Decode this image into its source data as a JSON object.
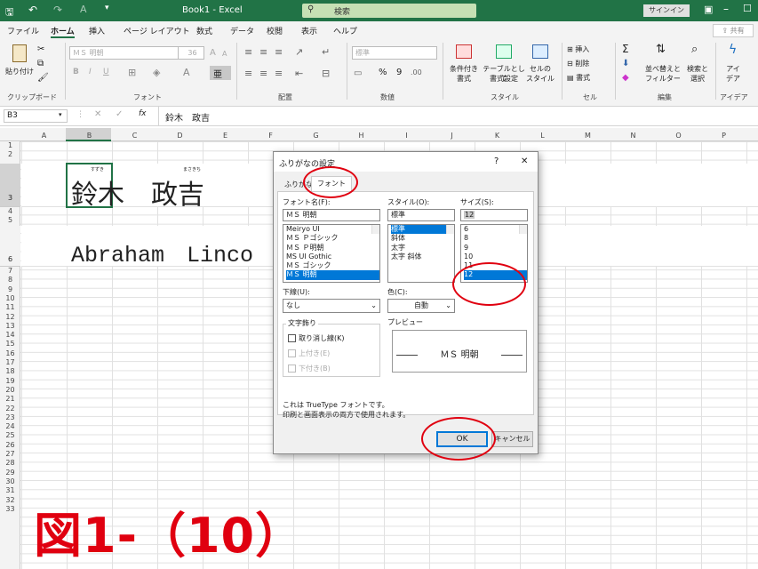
{
  "title_bar": {
    "title": "Book1 - Excel",
    "search_placeholder": "検索",
    "signin": "サインイン"
  },
  "menu": {
    "tabs": [
      "ファイル",
      "ホーム",
      "挿入",
      "ページ レイアウト",
      "数式",
      "データ",
      "校閲",
      "表示",
      "ヘルプ"
    ],
    "share": "共有"
  },
  "ribbon": {
    "paste": "貼り付け",
    "clipboard": "クリップボード",
    "font_name": "ＭＳ 明朝",
    "font_size": "36",
    "font_group": "フォント",
    "alignment_group": "配置",
    "number_format": "標準",
    "number_group": "数値",
    "conditional": [
      "条件付き",
      "書式"
    ],
    "table": [
      "テーブルとして",
      "書式設定"
    ],
    "cellstyle": [
      "セルの",
      "スタイル"
    ],
    "style_group": "スタイル",
    "insert": "挿入",
    "delete": "削除",
    "format": "書式",
    "cell_group": "セル",
    "sort": [
      "並べ替えと",
      "フィルター"
    ],
    "find": [
      "検索と",
      "選択"
    ],
    "edit_group": "編集",
    "ideas": [
      "アイ",
      "デア"
    ],
    "ideas_group": "アイデア",
    "bold": "B",
    "italic": "I",
    "underline": "U",
    "percent": "%",
    "comma": "9"
  },
  "formula_bar": {
    "name_box": "B3",
    "fx": "fx",
    "formula": "鈴木　政吉"
  },
  "columns": [
    "A",
    "B",
    "C",
    "D",
    "E",
    "F",
    "G",
    "H",
    "I",
    "J",
    "K",
    "L",
    "M",
    "N",
    "O",
    "P"
  ],
  "rows": [
    "1",
    "2",
    "3",
    "4",
    "5",
    "6",
    "7",
    "8",
    "9",
    "10",
    "11",
    "12",
    "13",
    "14",
    "15",
    "16",
    "17",
    "18",
    "19",
    "20",
    "21",
    "22",
    "23",
    "24",
    "25",
    "26",
    "27",
    "28",
    "29",
    "30",
    "31",
    "32",
    "33"
  ],
  "cells": {
    "b3_text": "鈴木　政吉",
    "furigana1": "すずき",
    "furigana2": "まさきち",
    "b6_text": "Abraham　Linco"
  },
  "figure_label": "図1-（10）",
  "dialog": {
    "title": "ふりがなの設定",
    "help": "?",
    "close": "✕",
    "tab1": "ふりがな",
    "tab2": "フォント",
    "font_label": "フォント名(F):",
    "font_value": "ＭＳ 明朝",
    "fonts": [
      "Meiryo UI",
      "ＭＳ Ｐゴシック",
      "ＭＳ Ｐ明朝",
      "MS UI Gothic",
      "ＭＳ ゴシック",
      "ＭＳ 明朝"
    ],
    "style_label": "スタイル(O):",
    "style_value": "標準",
    "styles": [
      "標準",
      "斜体",
      "太字",
      "太字 斜体"
    ],
    "size_label": "サイズ(S):",
    "size_value": "12",
    "sizes": [
      "6",
      "8",
      "9",
      "10",
      "11",
      "12"
    ],
    "underline_label": "下線(U):",
    "underline_value": "なし",
    "color_label": "色(C):",
    "color_value": "自動",
    "effects_label": "文字飾り",
    "strike": "取り消し線(K)",
    "superscript": "上付き(E)",
    "subscript": "下付き(B)",
    "preview_label": "プレビュー",
    "preview_text": "ＭＳ 明朝",
    "info1": "これは TrueType フォントです。",
    "info2": "印刷と画面表示の両方で使用されます。",
    "ok": "OK",
    "cancel": "キャンセル"
  },
  "colors": {
    "excel_green": "#217346",
    "highlight_red": "#e00010",
    "selection_blue": "#0078d7"
  }
}
